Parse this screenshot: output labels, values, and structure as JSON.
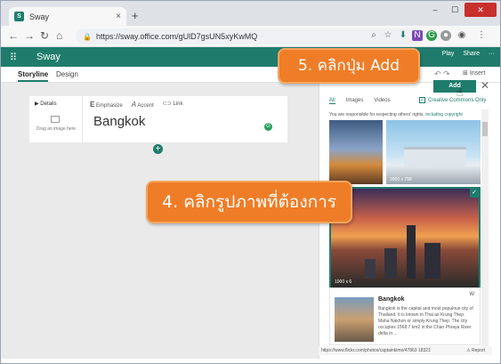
{
  "browser": {
    "tab_title": "Sway",
    "tab_close": "×",
    "new_tab": "+",
    "url": "https://sway.office.com/gUlD7gsUN5xyKwMQ",
    "window_controls": [
      "–",
      "☐",
      "✕"
    ]
  },
  "sway": {
    "app_name": "Sway",
    "right_actions": [
      "Play",
      "Share",
      "···"
    ],
    "tabs": {
      "storyline": "Storyline",
      "design": "Design"
    },
    "insert_label": "Insert"
  },
  "card": {
    "details_label": "Details",
    "drag_hint": "Drag an image here",
    "tools": [
      "Emphasize",
      "Accent",
      "Link"
    ],
    "heading": "Bangkok"
  },
  "pane": {
    "add_label": "Add",
    "tabs": [
      "All",
      "Images",
      "Videos"
    ],
    "creative_commons": "Creative Commons Only",
    "notice": "You are responsible for respecting others' rights,",
    "notice_link": "including copyright",
    "size_b": "3000 x 798",
    "size_c": "1000 x 6",
    "result_title": "Bangkok",
    "result_text": "Bangkok is the capital and most populous city of Thailand. It is known in Thai as Krung Thep Maha Nakhon or simply Krung Thep. The city occupies 1568.7 km2 in the Chao Phraya River delta in ...",
    "status_url": "https://www.flickr.com/photos/captainkimo/47863 18321",
    "report_label": "Report"
  },
  "callouts": {
    "step5": "5. คลิกปุ่ม Add",
    "step4": "4. คลิกรูปภาพที่ต้องการ"
  },
  "colors": {
    "sway_green": "#1f7c6d",
    "callout_orange": "#ef7d27"
  }
}
